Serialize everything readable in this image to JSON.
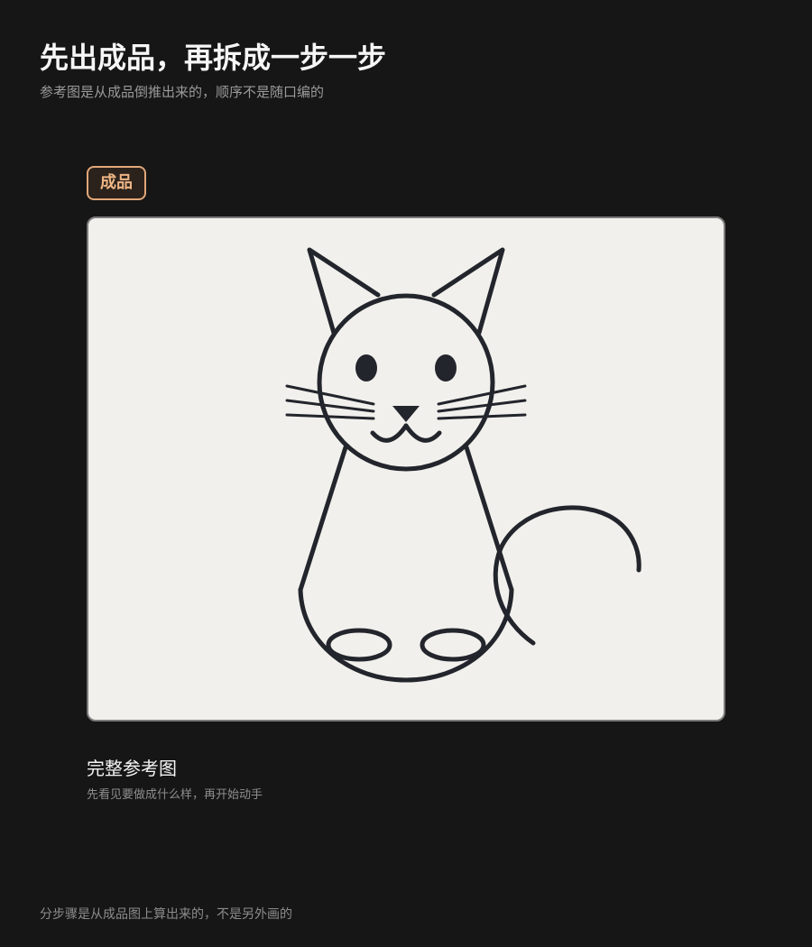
{
  "header": {
    "title": "先出成品，再拆成一步一步",
    "subtitle": "参考图是从成品倒推出来的，顺序不是随口编的"
  },
  "stage": {
    "badge_label": "成品"
  },
  "illustration": {
    "subject": "cat line drawing",
    "stroke_color": "#23252c",
    "background_color": "#f1f0ec"
  },
  "caption": {
    "title": "完整参考图",
    "subtitle": "先看见要做成什么样，再开始动手"
  },
  "footer": {
    "note": "分步骤是从成品图上算出来的，不是另外画的"
  },
  "colors": {
    "page_background": "#161616",
    "accent": "#e2a779",
    "title_text": "#f6f6f6",
    "muted_text": "#9a9a9a"
  }
}
